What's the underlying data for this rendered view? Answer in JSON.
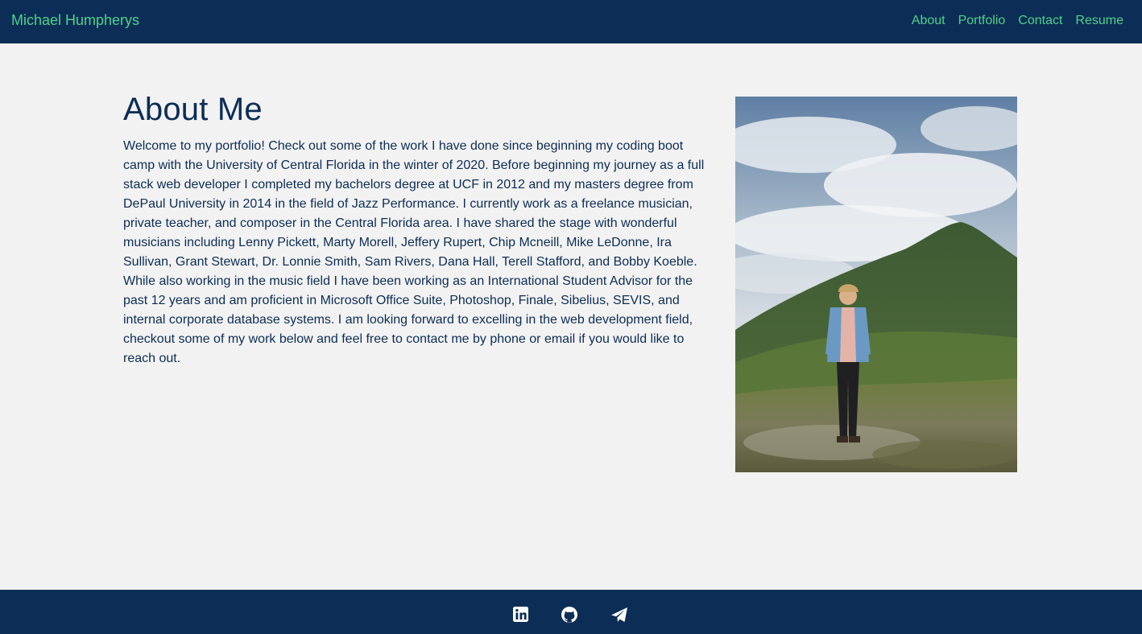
{
  "navbar": {
    "brand": "Michael Humpherys",
    "links": [
      {
        "label": "About"
      },
      {
        "label": "Portfolio"
      },
      {
        "label": "Contact"
      },
      {
        "label": "Resume"
      }
    ],
    "background_color": "#0c2d55",
    "link_color": "#4fd28c"
  },
  "about": {
    "title": "About Me",
    "body": "Welcome to my portfolio! Check out some of the work I have done since beginning my coding boot camp with the University of Central Florida in the winter of 2020. Before beginning my journey as a full stack web developer I completed my bachelors degree at UCF in 2012 and my masters degree from DePaul University in 2014 in the field of Jazz Performance. I currently work as a freelance musician, private teacher, and composer in the Central Florida area. I have shared the stage with wonderful musicians including Lenny Pickett, Marty Morell, Jeffery Rupert, Chip Mcneill, Mike LeDonne, Ira Sullivan, Grant Stewart, Dr. Lonnie Smith, Sam Rivers, Dana Hall, Terell Stafford, and Bobby Koeble. While also working in the music field I have been working as an International Student Advisor for the past 12 years and am proficient in Microsoft Office Suite, Photoshop, Finale, Sibelius, SEVIS, and internal corporate database systems. I am looking forward to excelling in the web development field, checkout some of my work below and feel free to contact me by phone or email if you would like to reach out.",
    "text_color": "#0c2d55"
  },
  "footer": {
    "icons": [
      {
        "icon": "linkedin-icon"
      },
      {
        "icon": "github-icon"
      },
      {
        "icon": "paper-plane-icon"
      }
    ],
    "background_color": "#0c2d55"
  }
}
